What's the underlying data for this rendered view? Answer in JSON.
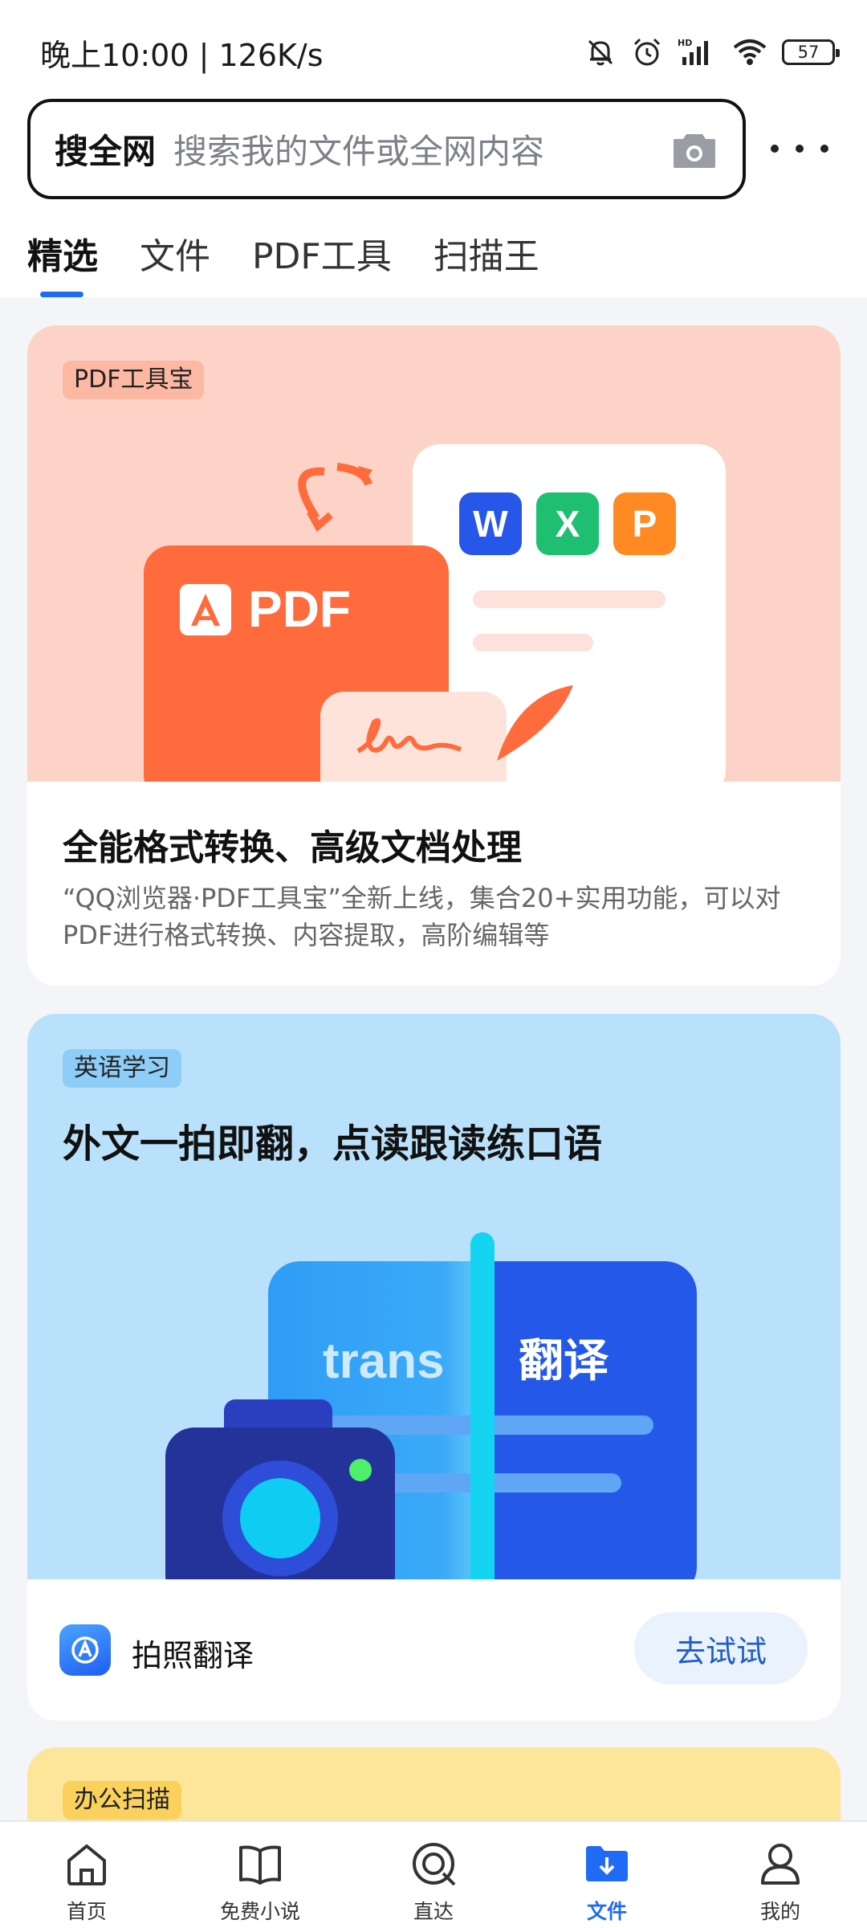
{
  "status_bar": {
    "time": "晚上10:00 | 126K/s",
    "battery": "57",
    "icons": [
      "mute-bell-icon",
      "alarm-icon",
      "hd-signal-icon",
      "wifi-icon",
      "battery-icon"
    ]
  },
  "search": {
    "scope_label": "搜全网",
    "placeholder": "搜索我的文件或全网内容",
    "camera_icon": "camera-icon"
  },
  "more_icon": "more-dots-icon",
  "tabs": [
    {
      "label": "精选",
      "active": true
    },
    {
      "label": "文件",
      "active": false
    },
    {
      "label": "PDF工具",
      "active": false
    },
    {
      "label": "扫描王",
      "active": false
    }
  ],
  "card_pdf": {
    "tag": "PDF工具宝",
    "illustration": {
      "pdf_label": "PDF",
      "office_letters": [
        "W",
        "X",
        "P"
      ]
    },
    "title": "全能格式转换、高级文档处理",
    "description": "“QQ浏览器·PDF工具宝”全新上线，集合20+实用功能，可以对PDF进行格式转换、内容提取，高阶编辑等"
  },
  "card_translate": {
    "tag": "英语学习",
    "headline": "外文一拍即翻，点读跟读练口语",
    "illustration": {
      "source_word": "trans",
      "target_word": "翻译"
    },
    "app_name": "拍照翻译",
    "button": "去试试"
  },
  "card_scan": {
    "tag": "办公扫描"
  },
  "bottom_nav": [
    {
      "label": "首页",
      "icon": "home-icon",
      "active": false
    },
    {
      "label": "免费小说",
      "icon": "book-icon",
      "active": false
    },
    {
      "label": "直达",
      "icon": "direct-icon",
      "active": false
    },
    {
      "label": "文件",
      "icon": "folder-download-icon",
      "active": true
    },
    {
      "label": "我的",
      "icon": "profile-icon",
      "active": false
    }
  ],
  "colors": {
    "accent": "#1f6bf5",
    "pdf_hero_bg": "#fcd3c6",
    "translate_hero_bg": "#bae1fb",
    "scan_card_bg": "#fde69a"
  }
}
